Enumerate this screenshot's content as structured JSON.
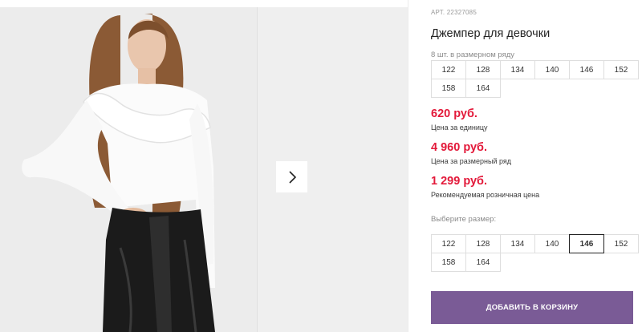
{
  "product": {
    "article_label": "АРТ.",
    "article_number": "22327085",
    "title": "Джемпер для девочки",
    "pack_subtitle": "8 шт. в размерном ряду"
  },
  "size_row": [
    "122",
    "128",
    "134",
    "140",
    "146",
    "152",
    "158",
    "164"
  ],
  "prices": [
    {
      "value": "620 руб.",
      "label": "Цена за единицу"
    },
    {
      "value": "4 960 руб.",
      "label": "Цена за размерный ряд"
    },
    {
      "value": "1 299 руб.",
      "label": "Рекомендуемая розничная цена"
    }
  ],
  "size_select": {
    "label": "Выберите размер:",
    "options": [
      "122",
      "128",
      "134",
      "140",
      "146",
      "152",
      "158",
      "164"
    ],
    "selected": "146"
  },
  "cart_button": "ДОБАВИТЬ В КОРЗИНУ",
  "gallery": {
    "next_icon": "chevron-right-icon",
    "alt": "product-photo"
  },
  "colors": {
    "price": "#e3193a",
    "accent_button": "#7a5b96"
  }
}
